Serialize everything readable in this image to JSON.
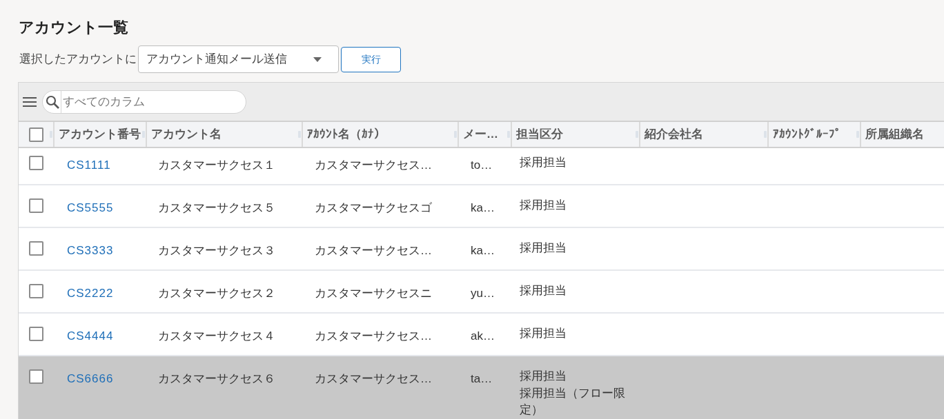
{
  "page": {
    "title": "アカウント一覧"
  },
  "bulk_action": {
    "label": "選択したアカウントに",
    "select": {
      "value": "アカウント通知メール送信"
    },
    "button": "実行"
  },
  "grid": {
    "search": {
      "placeholder": "すべてのカラム"
    },
    "select_all": {
      "checked": false
    },
    "columns": [
      "アカウント番号",
      "アカウント名",
      "ｱｶｳﾝﾄ名（ｶﾅ）",
      "メー…",
      "担当区分",
      "紹介会社名",
      "ｱｶｳﾝﾄｸﾞﾙｰﾌﾟ",
      "所属組織名"
    ],
    "rows": [
      {
        "checked": false,
        "highlighted": false,
        "account_number": "CS1111",
        "account_name": "カスタマーサクセス１",
        "account_name_kana": "カスタマーサクセス…",
        "column_4": "to…",
        "assignment": [
          "採用担当"
        ]
      },
      {
        "checked": false,
        "highlighted": false,
        "account_number": "CS5555",
        "account_name": "カスタマーサクセス５",
        "account_name_kana": "カスタマーサクセスゴ",
        "column_4": "ka…",
        "assignment": [
          "採用担当"
        ]
      },
      {
        "checked": false,
        "highlighted": false,
        "account_number": "CS3333",
        "account_name": "カスタマーサクセス３",
        "account_name_kana": "カスタマーサクセス…",
        "column_4": "ka…",
        "assignment": [
          "採用担当"
        ]
      },
      {
        "checked": false,
        "highlighted": false,
        "account_number": "CS2222",
        "account_name": "カスタマーサクセス２",
        "account_name_kana": "カスタマーサクセスニ",
        "column_4": "yu…",
        "assignment": [
          "採用担当"
        ]
      },
      {
        "checked": false,
        "highlighted": false,
        "account_number": "CS4444",
        "account_name": "カスタマーサクセス４",
        "account_name_kana": "カスタマーサクセス…",
        "column_4": "ak…",
        "assignment": [
          "採用担当"
        ]
      },
      {
        "checked": false,
        "highlighted": true,
        "account_number": "CS6666",
        "account_name": "カスタマーサクセス６",
        "account_name_kana": "カスタマーサクセス…",
        "column_4": "ta…",
        "assignment": [
          "採用担当",
          "採用担当（フロー限定）"
        ]
      }
    ]
  }
}
